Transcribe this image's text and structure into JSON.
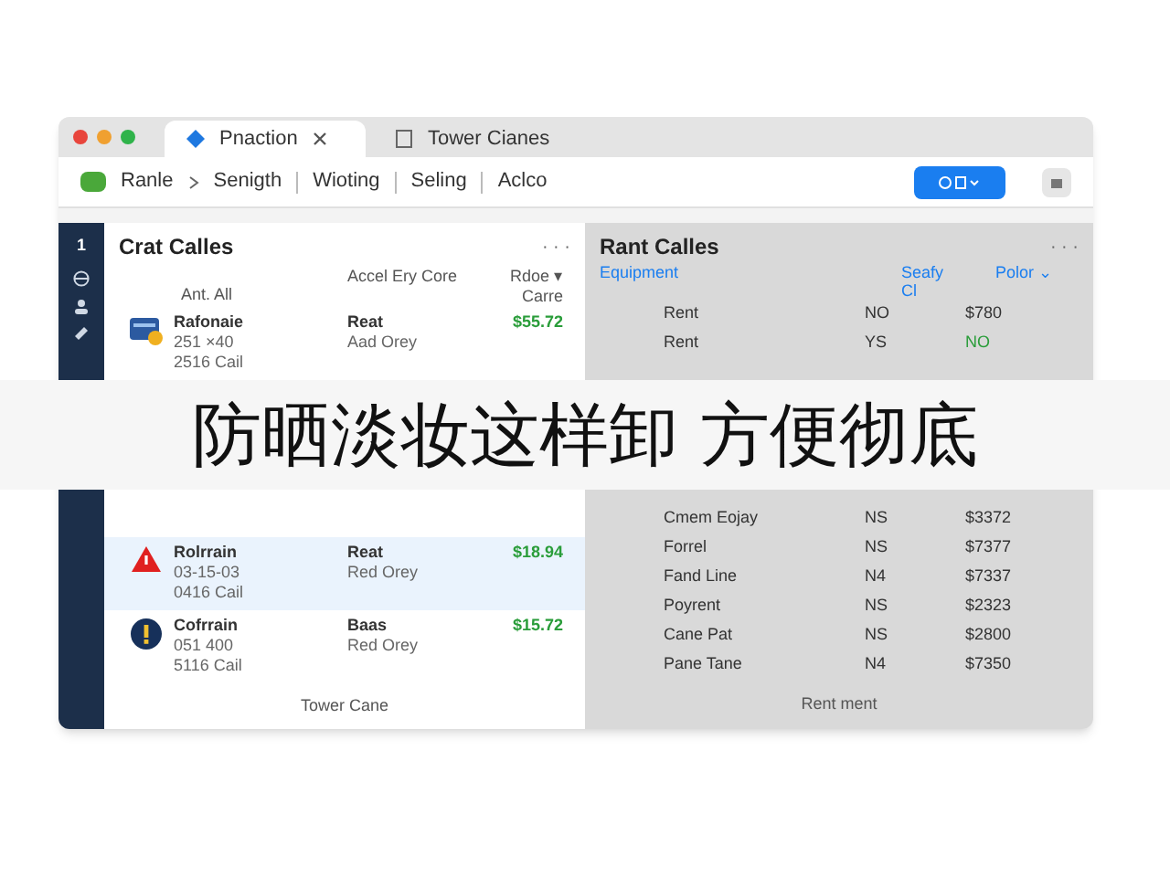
{
  "tabs": [
    {
      "label": "Pnaction",
      "selected": true
    },
    {
      "label": "Tower Cianes",
      "selected": false
    }
  ],
  "toolbar": {
    "crumbs": [
      "Ranle",
      "Senigth",
      "Wioting",
      "Seling",
      "Aclco"
    ]
  },
  "sidebar": {
    "badge": "1"
  },
  "left_panel": {
    "title": "Crat Calles",
    "more": "· · ·",
    "columns": [
      "Ant. All",
      "Accel Ery Core",
      "Rdoe ▾ Carre"
    ],
    "rows": [
      {
        "kind": "card",
        "name": "Rafonaie",
        "line2": "251 ×40",
        "line3": "2516 Cail",
        "col2": "Reat",
        "col2b": "Aad Orey",
        "price": "$55.72",
        "selected": false
      },
      {
        "kind": "warning",
        "name": "Rolrrain",
        "line2": "03-15-03",
        "line3": "0416 Cail",
        "col2": "Reat",
        "col2b": "Red Orey",
        "price": "$18.94",
        "selected": true
      },
      {
        "kind": "alert",
        "name": "Cofrrain",
        "line2": "051 400",
        "line3": "5116 Cail",
        "col2": "Baas",
        "col2b": "Red Orey",
        "price": "$15.72",
        "selected": false
      }
    ],
    "footer": "Tower Cane"
  },
  "right_panel": {
    "title": "Rant Calles",
    "more": "· · ·",
    "columns": [
      "Equipment",
      "Seafy Cl",
      "Polor ⌄"
    ],
    "rows": [
      {
        "name": "Rent",
        "code": "NO",
        "value": "$780",
        "color": "#333333"
      },
      {
        "name": "Rent",
        "code": "YS",
        "value": "NO",
        "color": "#2a9d3a"
      },
      {
        "name": "Cmem Eojay",
        "code": "NS",
        "value": "$3372",
        "color": "#333333"
      },
      {
        "name": "Forrel",
        "code": "NS",
        "value": "$7377",
        "color": "#333333"
      },
      {
        "name": "Fand Line",
        "code": "N4",
        "value": "$7337",
        "color": "#333333"
      },
      {
        "name": "Poyrent",
        "code": "NS",
        "value": "$2323",
        "color": "#333333"
      },
      {
        "name": "Cane Pat",
        "code": "NS",
        "value": "$2800",
        "color": "#333333"
      },
      {
        "name": "Pane Tane",
        "code": "N4",
        "value": "$7350",
        "color": "#333333"
      }
    ],
    "footer": "Rent ment"
  },
  "caption": "防晒淡妆这样卸 方便彻底"
}
